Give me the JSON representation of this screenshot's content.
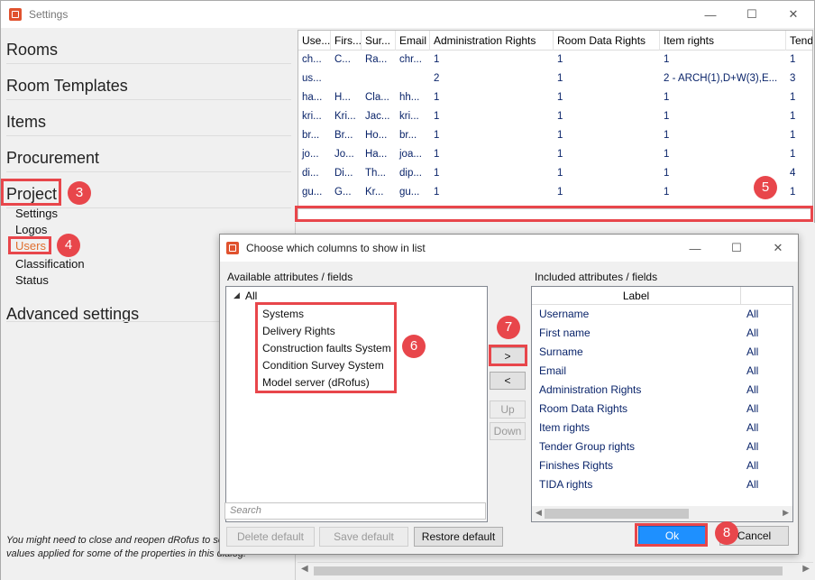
{
  "window": {
    "title": "Settings"
  },
  "nav": {
    "headers": [
      "Rooms",
      "Room Templates",
      "Items",
      "Procurement",
      "Project",
      "Advanced settings"
    ],
    "project_items": [
      "Settings",
      "Logos",
      "Users",
      "Classification",
      "Status"
    ],
    "note": "You might need to close and reopen dRofus to see new values applied for some of the properties in this dialog."
  },
  "grid": {
    "columns": [
      "Use...",
      "Firs...",
      "Sur...",
      "Email",
      "Administration Rights",
      "Room Data Rights",
      "Item rights",
      "Tende"
    ],
    "rows": [
      [
        "ch...",
        "C...",
        "Ra...",
        "chr...",
        "1",
        "1",
        "1",
        "1"
      ],
      [
        "us...",
        "",
        "",
        "",
        "2",
        "1",
        "2 - ARCH(1),D+W(3),E...",
        "3"
      ],
      [
        "ha...",
        "H...",
        "Cla...",
        "hh...",
        "1",
        "1",
        "1",
        "1"
      ],
      [
        "kri...",
        "Kri...",
        "Jac...",
        "kri...",
        "1",
        "1",
        "1",
        "1"
      ],
      [
        "br...",
        "Br...",
        "Ho...",
        "br...",
        "1",
        "1",
        "1",
        "1"
      ],
      [
        "jo...",
        "Jo...",
        "Ha...",
        "joa...",
        "1",
        "1",
        "1",
        "1"
      ],
      [
        "di...",
        "Di...",
        "Th...",
        "dip...",
        "1",
        "1",
        "1",
        "4"
      ],
      [
        "gu...",
        "G...",
        "Kr...",
        "gu...",
        "1",
        "1",
        "1",
        "1"
      ]
    ]
  },
  "dialog": {
    "title": "Choose which columns to show in list",
    "available_label": "Available attributes / fields",
    "included_label": "Included attributes / fields",
    "tree_root": "All",
    "available_items": [
      "Systems",
      "Delivery Rights",
      "Construction faults System",
      "Condition Survey System",
      "Model server (dRofus)"
    ],
    "search_placeholder": "Search",
    "included_header": "Label",
    "included_items": [
      {
        "label": "Username",
        "scope": "All"
      },
      {
        "label": "First name",
        "scope": "All"
      },
      {
        "label": "Surname",
        "scope": "All"
      },
      {
        "label": "Email",
        "scope": "All"
      },
      {
        "label": "Administration Rights",
        "scope": "All"
      },
      {
        "label": "Room Data Rights",
        "scope": "All"
      },
      {
        "label": "Item rights",
        "scope": "All"
      },
      {
        "label": "Tender Group rights",
        "scope": "All"
      },
      {
        "label": "Finishes Rights",
        "scope": "All"
      },
      {
        "label": "TIDA rights",
        "scope": "All"
      }
    ],
    "buttons": {
      "add": ">",
      "remove": "<",
      "up": "Up",
      "down": "Down",
      "delete_default": "Delete default",
      "save_default": "Save default",
      "restore_default": "Restore default",
      "ok": "Ok",
      "cancel": "Cancel"
    }
  },
  "annotations": [
    "3",
    "4",
    "5",
    "6",
    "7",
    "8"
  ],
  "colors": {
    "highlight": "#e8464b",
    "accent": "#1e90ff"
  }
}
